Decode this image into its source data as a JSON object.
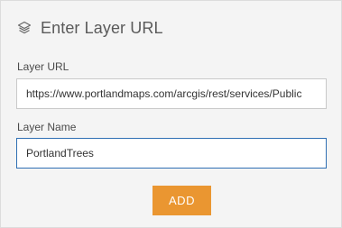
{
  "header": {
    "icon": "layers-icon",
    "title": "Enter Layer URL"
  },
  "form": {
    "url_label": "Layer URL",
    "url_value": "https://www.portlandmaps.com/arcgis/rest/services/Public",
    "name_label": "Layer Name",
    "name_value": "PortlandTrees"
  },
  "actions": {
    "add_label": "ADD"
  },
  "colors": {
    "accent": "#ea9631",
    "focus_border": "#2f6fb3",
    "background": "#f4f4f4"
  }
}
